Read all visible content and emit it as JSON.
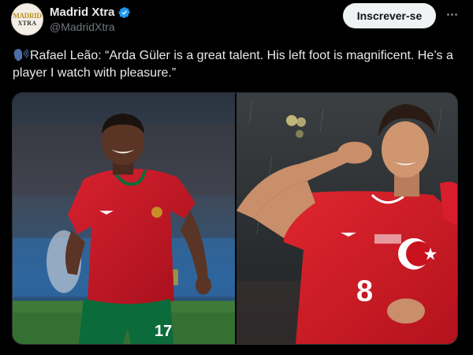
{
  "author": {
    "avatar_line1": "MADRID",
    "avatar_line2": "XTRA",
    "name": "Madrid Xtra",
    "handle": "@MadridXtra",
    "verified": true
  },
  "actions": {
    "follow_label": "Inscrever-se",
    "more_icon": "ellipsis-icon"
  },
  "tweet": {
    "icon": "speaking-head-icon",
    "text": "Rafael Leão: “Arda Güler is a great talent. His left foot is magnificent. He’s a player I watch with pleasure.”"
  },
  "media": {
    "left_photo": {
      "shirt_number": "17"
    },
    "right_photo": {
      "shirt_number": "8"
    }
  },
  "colors": {
    "background": "#000000",
    "text": "#e7e9ea",
    "secondary_text": "#71767b",
    "verified_blue": "#1d9bf0",
    "follow_button_bg": "#eff3f4",
    "portugal_red": "#c8102e",
    "portugal_green": "#0b6b3a",
    "turkey_red": "#d81e2c"
  }
}
